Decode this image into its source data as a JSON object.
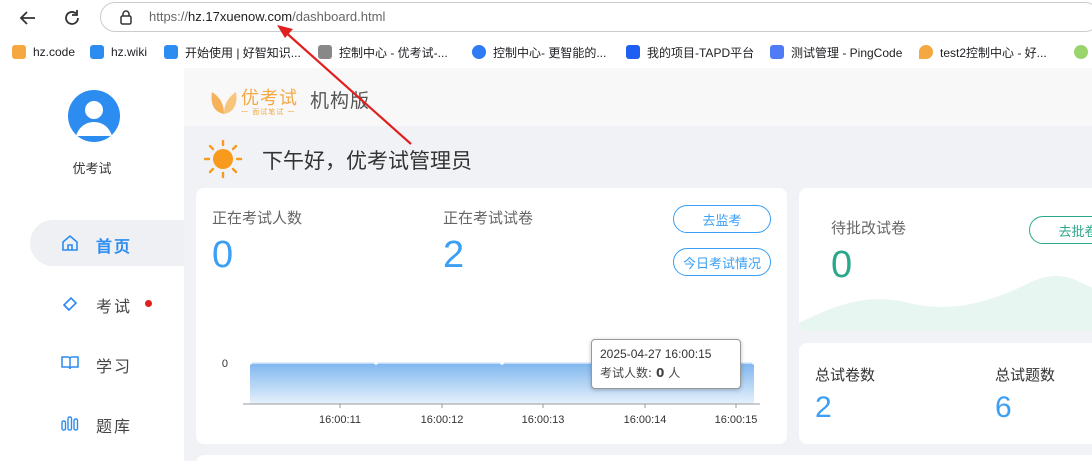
{
  "browser": {
    "url_prefix": "https://",
    "url_host": "hz.17xuenow.com",
    "url_path": "/dashboard.html",
    "bookmarks": [
      {
        "label": "hz.code",
        "color": "#f5a742"
      },
      {
        "label": "hz.wiki",
        "color": "#2d8cf0"
      },
      {
        "label": "开始使用 | 好智知识...",
        "color": "#2d8cf0"
      },
      {
        "label": "控制中心 - 优考试-...",
        "color": "#888888"
      },
      {
        "label": "控制中心- 更智能的...",
        "color": "#2f7bf6"
      },
      {
        "label": "我的项目-TAPD平台",
        "color": "#1d5ff2"
      },
      {
        "label": "测试管理 - PingCode",
        "color": "#4f7cf6"
      },
      {
        "label": "test2控制中心 - 好...",
        "color": "#f5a742"
      }
    ]
  },
  "sidebar": {
    "username": "优考试",
    "items": [
      {
        "label": "首页",
        "icon": "home-icon",
        "active": true
      },
      {
        "label": "考试",
        "icon": "tag-icon",
        "badge": true
      },
      {
        "label": "学习",
        "icon": "book-icon"
      },
      {
        "label": "题库",
        "icon": "bar-chart-icon"
      }
    ]
  },
  "header": {
    "logo": "优考试",
    "logo_sub": "一 面试笔试 一",
    "edition": "机构版"
  },
  "greeting": "下午好，优考试管理员",
  "exam_card": {
    "examinees_label": "正在考试人数",
    "examinees_value": "0",
    "papers_label": "正在考试试卷",
    "papers_value": "2",
    "monitor_button": "去监考",
    "today_button": "今日考试情况"
  },
  "grading_card": {
    "label": "待批改试卷",
    "value": "0",
    "button": "去批卷"
  },
  "totals_card": {
    "papers_label": "总试卷数",
    "papers_value": "2",
    "questions_label": "总试题数",
    "questions_value": "6"
  },
  "tooltip": {
    "time": "2025-04-27 16:00:15",
    "label": "考试人数:",
    "value": "0",
    "unit": "人"
  },
  "chart_data": {
    "type": "area",
    "x": [
      "16:00:11",
      "16:00:12",
      "16:00:13",
      "16:00:14",
      "16:00:15"
    ],
    "series": [
      {
        "values": [
          0,
          0,
          0,
          0,
          0
        ]
      }
    ],
    "y_ticks": [
      "0"
    ],
    "ylim": [
      0,
      1
    ],
    "colors": {
      "fill_top": "#7fb6ee",
      "fill_bottom": "#e6f1fc"
    }
  },
  "colors": {
    "accent": "#3a9ff5",
    "green": "#2aa88b",
    "orange": "#f5a742",
    "arrow": "#e02020"
  }
}
